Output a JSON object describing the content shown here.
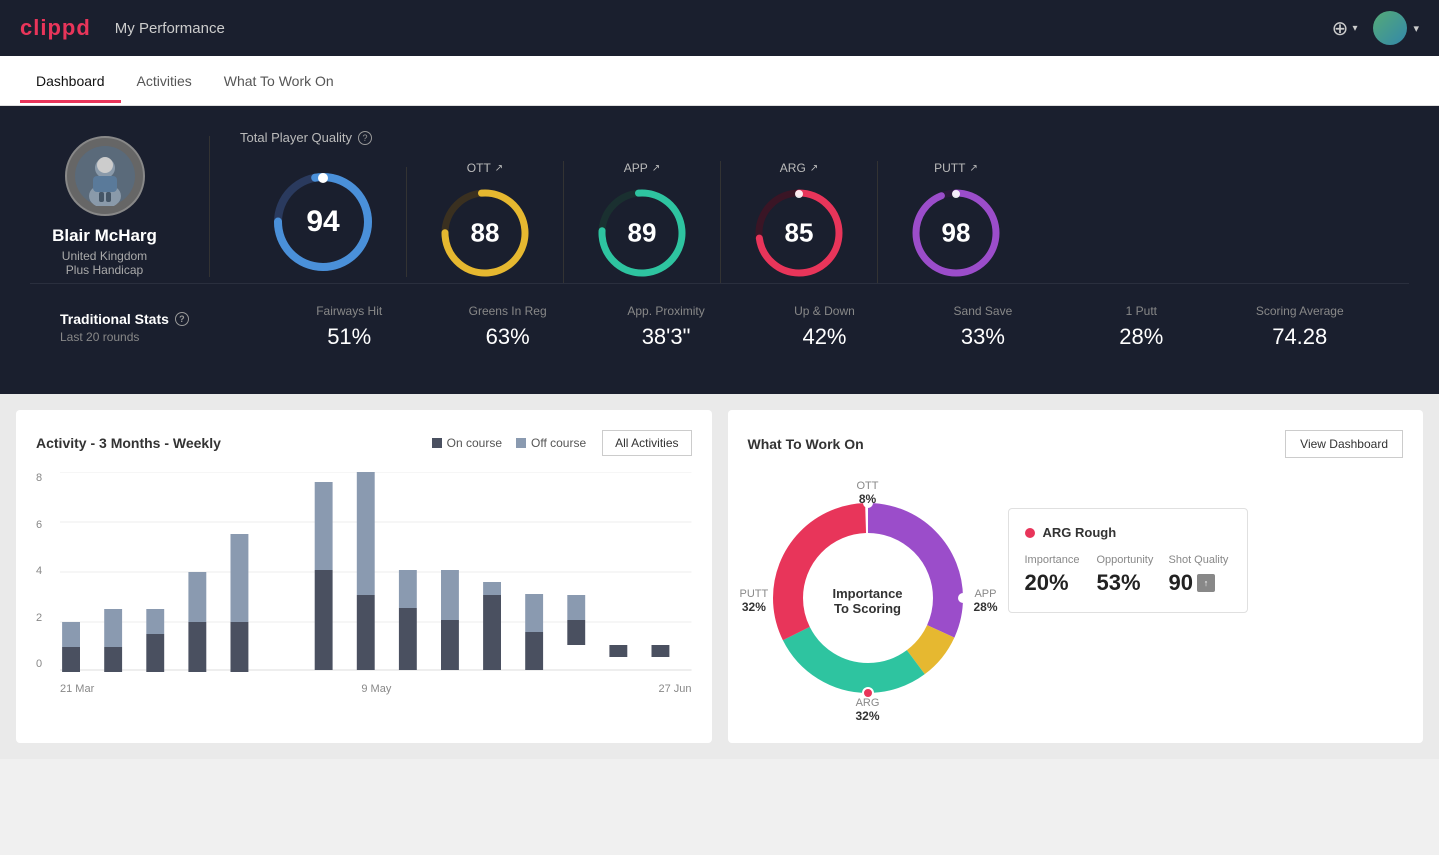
{
  "header": {
    "logo": "clippd",
    "title": "My Performance",
    "add_label": "⊕",
    "user_chevron": "▾"
  },
  "tabs": [
    {
      "label": "Dashboard",
      "active": true
    },
    {
      "label": "Activities",
      "active": false
    },
    {
      "label": "What To Work On",
      "active": false
    }
  ],
  "player": {
    "name": "Blair McHarg",
    "country": "United Kingdom",
    "handicap": "Plus Handicap"
  },
  "quality": {
    "label": "Total Player Quality",
    "scores": [
      {
        "id": "total",
        "value": "94",
        "color": "#4a90d9",
        "trail": "#2a3a5e",
        "label": null
      },
      {
        "id": "ott",
        "value": "88",
        "color": "#e6b830",
        "trail": "#3a3020",
        "label": "OTT"
      },
      {
        "id": "app",
        "value": "89",
        "color": "#2ec4a0",
        "trail": "#1a3030",
        "label": "APP"
      },
      {
        "id": "arg",
        "value": "85",
        "color": "#e8355a",
        "trail": "#3a1525",
        "label": "ARG"
      },
      {
        "id": "putt",
        "value": "98",
        "color": "#9b4dca",
        "trail": "#2a1a3a",
        "label": "PUTT"
      }
    ]
  },
  "traditional_stats": {
    "label": "Traditional Stats",
    "sub": "Last 20 rounds",
    "items": [
      {
        "name": "Fairways Hit",
        "value": "51%"
      },
      {
        "name": "Greens In Reg",
        "value": "63%"
      },
      {
        "name": "App. Proximity",
        "value": "38'3\""
      },
      {
        "name": "Up & Down",
        "value": "42%"
      },
      {
        "name": "Sand Save",
        "value": "33%"
      },
      {
        "name": "1 Putt",
        "value": "28%"
      },
      {
        "name": "Scoring Average",
        "value": "74.28"
      }
    ]
  },
  "activity_chart": {
    "title": "Activity - 3 Months - Weekly",
    "legend_on": "On course",
    "legend_off": "Off course",
    "all_btn": "All Activities",
    "y_labels": [
      "0",
      "2",
      "4",
      "6",
      "8"
    ],
    "x_labels": [
      "21 Mar",
      "9 May",
      "27 Jun"
    ],
    "bars": [
      {
        "on": 1,
        "off": 1
      },
      {
        "on": 1,
        "off": 1.5
      },
      {
        "on": 1.5,
        "off": 1
      },
      {
        "on": 2,
        "off": 2
      },
      {
        "on": 2,
        "off": 3.5
      },
      {
        "on": 0,
        "off": 0
      },
      {
        "on": 4,
        "off": 4.5
      },
      {
        "on": 3,
        "off": 5
      },
      {
        "on": 2.5,
        "off": 1.5
      },
      {
        "on": 2,
        "off": 2
      },
      {
        "on": 3,
        "off": 0.5
      },
      {
        "on": 1.5,
        "off": 1.5
      },
      {
        "on": 2,
        "off": 1
      },
      {
        "on": 0.5,
        "off": 0
      },
      {
        "on": 0.5,
        "off": 0
      }
    ]
  },
  "work_on": {
    "title": "What To Work On",
    "view_btn": "View Dashboard",
    "donut_center_line1": "Importance",
    "donut_center_line2": "To Scoring",
    "segments": [
      {
        "label": "OTT",
        "value": "8%",
        "color": "#e6b830",
        "position": "top"
      },
      {
        "label": "APP",
        "value": "28%",
        "color": "#2ec4a0",
        "position": "right"
      },
      {
        "label": "ARG",
        "value": "32%",
        "color": "#e8355a",
        "position": "bottom"
      },
      {
        "label": "PUTT",
        "value": "32%",
        "color": "#9b4dca",
        "position": "left"
      }
    ],
    "info_card": {
      "title": "ARG Rough",
      "metrics": [
        {
          "name": "Importance",
          "value": "20%"
        },
        {
          "name": "Opportunity",
          "value": "53%"
        },
        {
          "name": "Shot Quality",
          "value": "90",
          "badge": true
        }
      ]
    }
  }
}
